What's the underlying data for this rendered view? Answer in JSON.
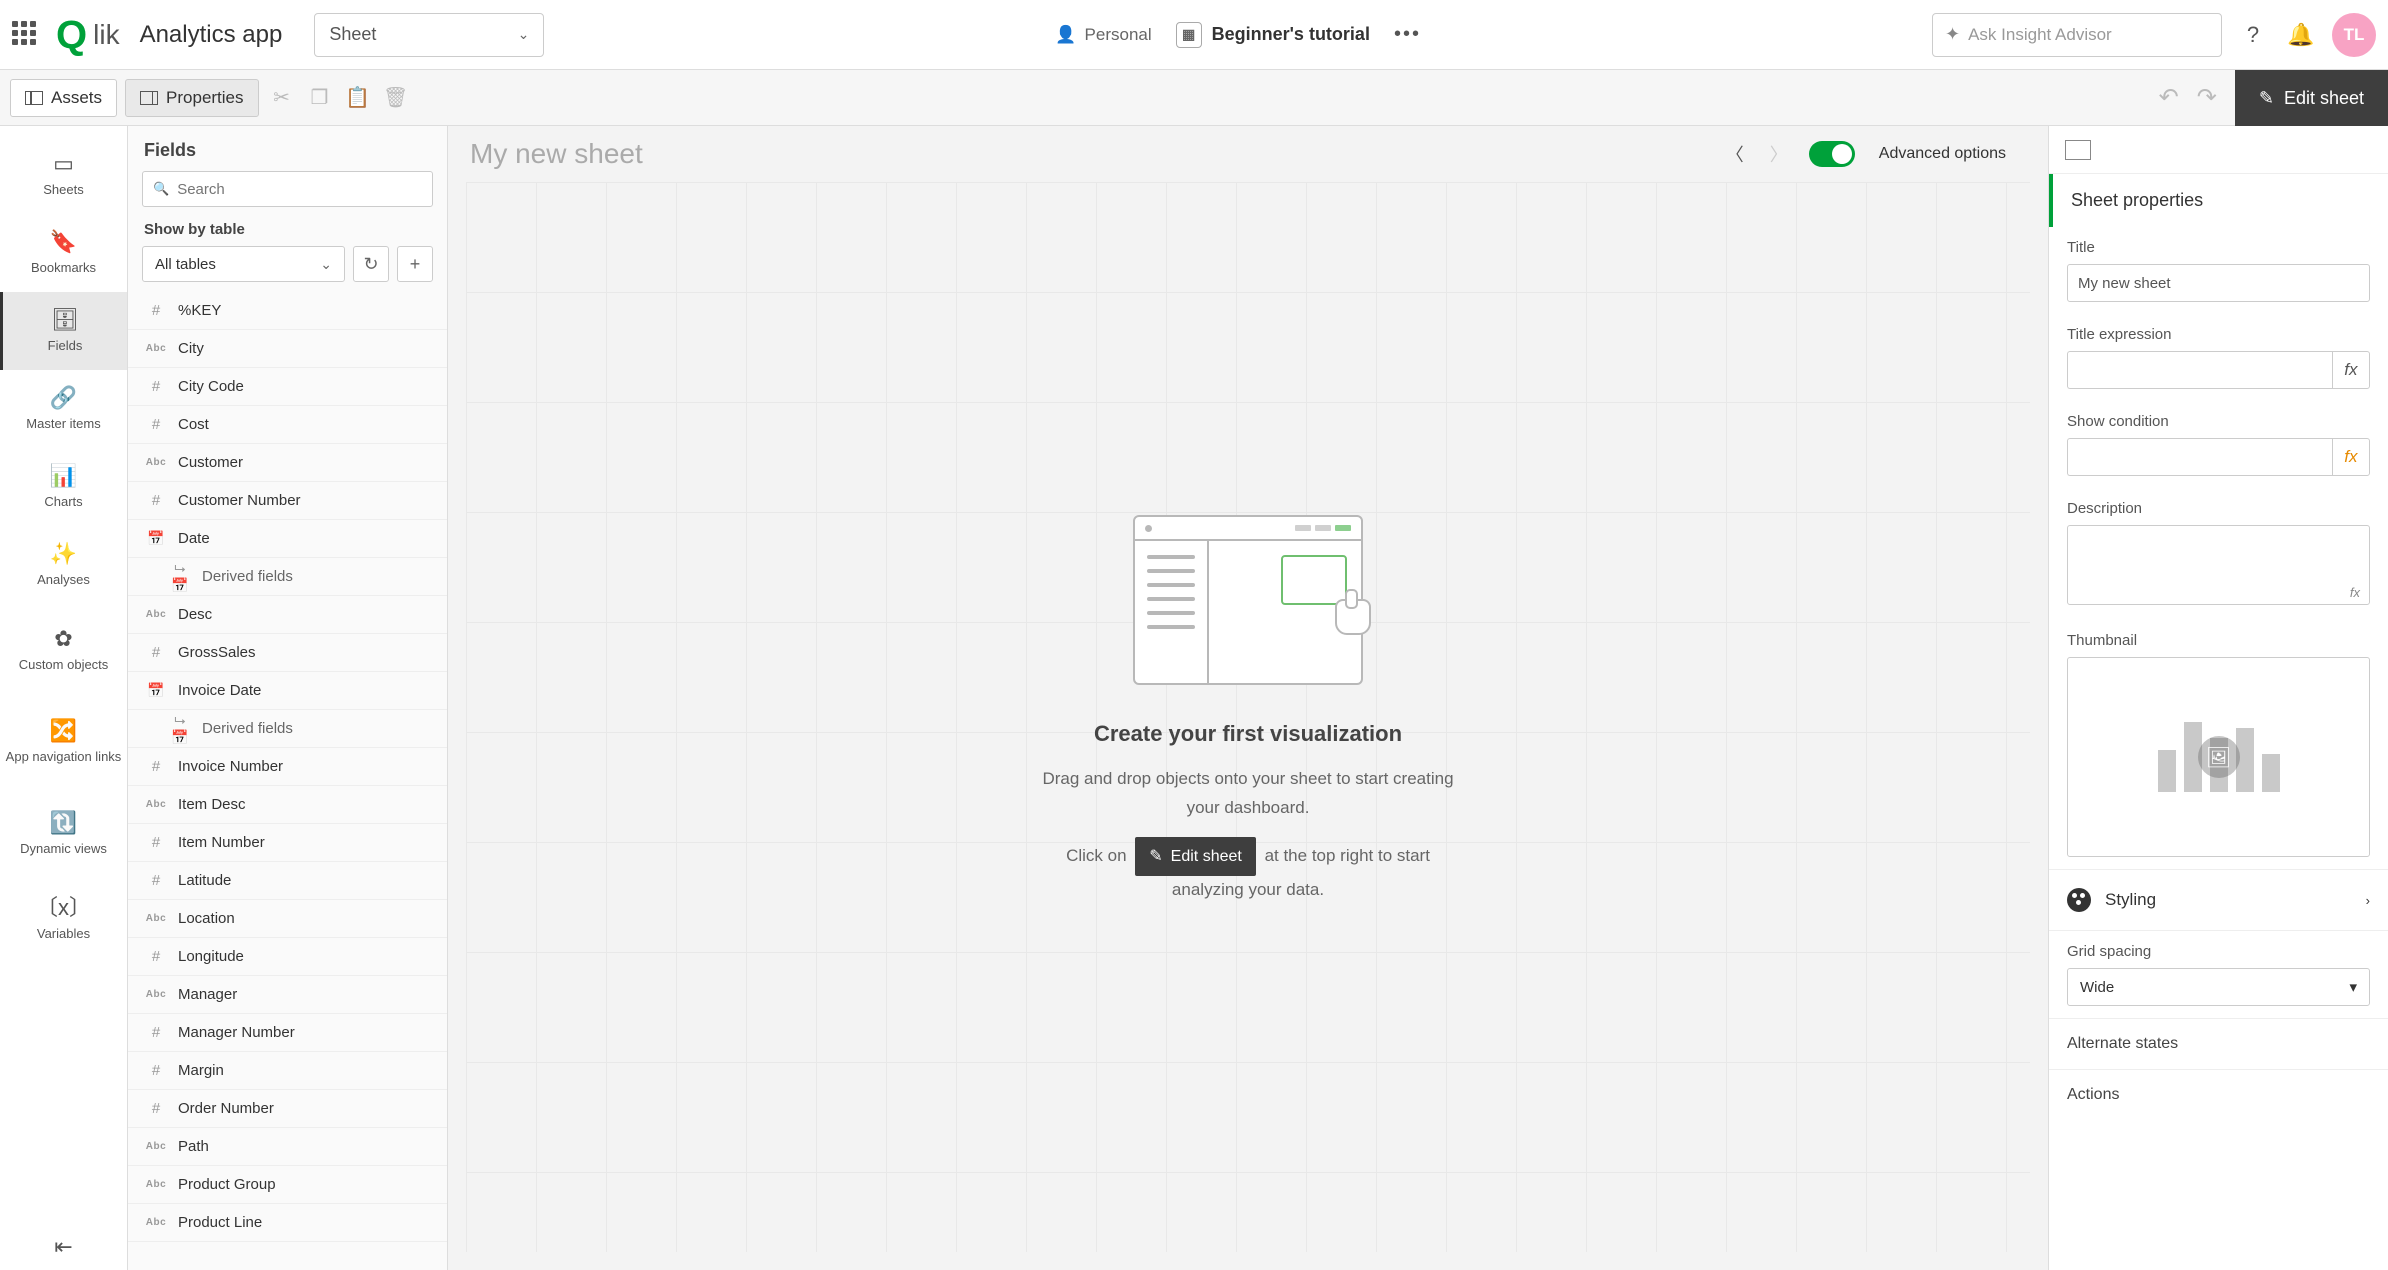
{
  "topbar": {
    "app_title": "Analytics app",
    "sheet_dropdown": "Sheet",
    "personal": "Personal",
    "tutorial": "Beginner's tutorial",
    "ask_placeholder": "Ask Insight Advisor",
    "avatar_initials": "TL"
  },
  "toolbar": {
    "assets": "Assets",
    "properties": "Properties",
    "edit_sheet": "Edit sheet"
  },
  "rail": {
    "sheets": "Sheets",
    "bookmarks": "Bookmarks",
    "fields": "Fields",
    "master_items": "Master items",
    "charts": "Charts",
    "analyses": "Analyses",
    "custom_objects": "Custom objects",
    "app_nav_links": "App navigation links",
    "dynamic_views": "Dynamic views",
    "variables": "Variables"
  },
  "fields_panel": {
    "header": "Fields",
    "search_placeholder": "Search",
    "show_by": "Show by table",
    "all_tables": "All tables",
    "items": [
      {
        "type": "hash",
        "label": "%KEY"
      },
      {
        "type": "abc",
        "label": "City"
      },
      {
        "type": "hash",
        "label": "City Code"
      },
      {
        "type": "hash",
        "label": "Cost"
      },
      {
        "type": "abc",
        "label": "Customer"
      },
      {
        "type": "hash",
        "label": "Customer Number"
      },
      {
        "type": "cal",
        "label": "Date"
      },
      {
        "type": "derived",
        "label": "Derived fields"
      },
      {
        "type": "abc",
        "label": "Desc"
      },
      {
        "type": "hash",
        "label": "GrossSales"
      },
      {
        "type": "cal",
        "label": "Invoice Date"
      },
      {
        "type": "derived",
        "label": "Derived fields"
      },
      {
        "type": "hash",
        "label": "Invoice Number"
      },
      {
        "type": "abc",
        "label": "Item Desc"
      },
      {
        "type": "hash",
        "label": "Item Number"
      },
      {
        "type": "hash",
        "label": "Latitude"
      },
      {
        "type": "abc",
        "label": "Location"
      },
      {
        "type": "hash",
        "label": "Longitude"
      },
      {
        "type": "abc",
        "label": "Manager"
      },
      {
        "type": "hash",
        "label": "Manager Number"
      },
      {
        "type": "hash",
        "label": "Margin"
      },
      {
        "type": "hash",
        "label": "Order Number"
      },
      {
        "type": "abc",
        "label": "Path"
      },
      {
        "type": "abc",
        "label": "Product Group"
      },
      {
        "type": "abc",
        "label": "Product Line"
      }
    ]
  },
  "canvas": {
    "sheet_title": "My new sheet",
    "advanced_options": "Advanced options",
    "empty_heading": "Create your first visualization",
    "empty_line1": "Drag and drop objects onto your sheet to start creating your dashboard.",
    "empty_click_on": "Click on",
    "empty_edit_label": "Edit sheet",
    "empty_after": "at the top right to start analyzing your data."
  },
  "props": {
    "section_header": "Sheet properties",
    "title_label": "Title",
    "title_value": "My new sheet",
    "title_expr_label": "Title expression",
    "show_condition_label": "Show condition",
    "description_label": "Description",
    "thumbnail_label": "Thumbnail",
    "styling_label": "Styling",
    "grid_spacing_label": "Grid spacing",
    "grid_spacing_value": "Wide",
    "alternate_states": "Alternate states",
    "actions": "Actions"
  }
}
